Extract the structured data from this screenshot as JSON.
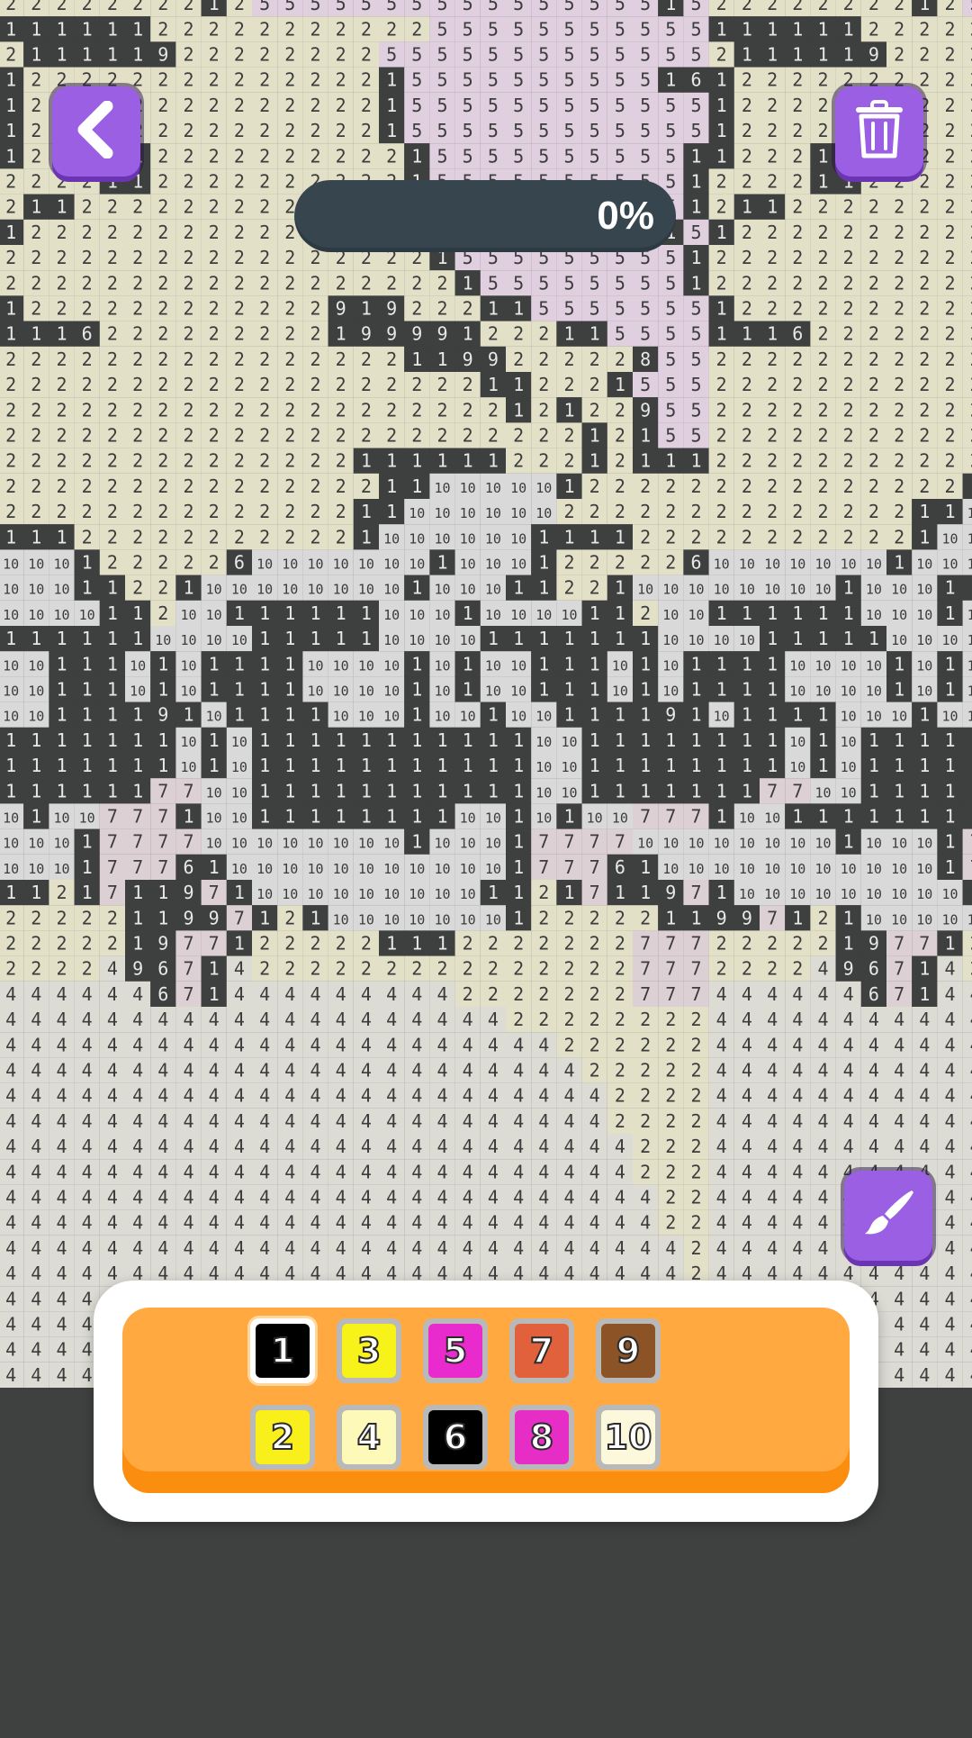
{
  "progress": {
    "value_percent": 0,
    "label": "0%"
  },
  "buttons": {
    "back_icon": "chevron-left-icon",
    "trash_icon": "trash-icon",
    "brush_icon": "paintbrush-icon",
    "accent": "#9b5fe3"
  },
  "palette": {
    "selected": "1",
    "colors": [
      {
        "label": "1",
        "hex": "#000000"
      },
      {
        "label": "3",
        "hex": "#f6f21a"
      },
      {
        "label": "5",
        "hex": "#e92bcd"
      },
      {
        "label": "7",
        "hex": "#e0613c"
      },
      {
        "label": "9",
        "hex": "#8c5326"
      },
      {
        "label": "2",
        "hex": "#f8ef1b"
      },
      {
        "label": "4",
        "hex": "#fdf9b8"
      },
      {
        "label": "6",
        "hex": "#000000"
      },
      {
        "label": "8",
        "hex": "#e62ec6"
      },
      {
        "label": "10",
        "hex": "#fcf8dc"
      }
    ]
  },
  "board": {
    "cell_colors": {
      "1": "#3e3f3f",
      "2": "#e3e0c8",
      "3": "#ece9a8",
      "4": "#dcdbd4",
      "5": "#dfcfdf",
      "6": "#3e3f3f",
      "7": "#ddd0d4",
      "8": "#3e3f3f",
      "9": "#3e3f3f",
      "10": "#d9d9d9"
    },
    "rows": [
      "2222222212555555555555555515",
      "1111112222222222255555555555",
      "2111119222222225555555555555",
      "1222222222222221555555555516",
      "1222222222222221555555555555",
      "1222222222222221555555555555",
      "1222112222222222155555555551",
      "2222112222222222155555555551",
      "2112222222222222155555555551",
      "1222222222222222155555555515",
      "2222222222222222215555555551",
      "2222222222222222221555555551",
      "1222222222222919222115555555",
      "1116222222222199991222115555",
      "2222222222222222119922222855",
      "2222222222222222222112221555",
      "2222222222222222222212122955",
      "2222222222222222222222212155",
      "2222222222222211111122212111",
      "2222222222222221110101010101",
      "2222222222222211101010101010",
      "1112222222222211010101010101",
      "1010101222226101010101010101",
      "1010101122110101010101010101",
      "1010101011210101111111010101",
      "1111111010101011111101010101",
      "1010111101101111101010101101",
      "1010111101101111101010101101",
      "1010111191101111101010110101",
      "1111111101101111111111110101",
      "1111111101101111111111110101",
      "1111117710101111111111110101",
      "1011010777110101111111110101",
      "1010101777710101010101010101",
      "1010101777611010101010101010",
      "1121711971101010101010101010",
      "2222211997121101010101010101",
      "2222219771222221112222222777",
      "2222496714222222222222222777",
      "4444446714444444442222222777",
      "4444444444444444444422222222",
      "4444444444444444444444222222",
      "4444444444444444444444422222",
      "4444444444444444444444442222",
      "4444444444444444444444442222",
      "4444444444444444444444444222",
      "4444444444444444444444444222",
      "4444444444444444444444444422",
      "4444444444444444444444444422",
      "4444444444444444444444444442",
      "4444444444444444444444444442",
      "4444444444444444444444444441",
      "4444444444444444444444444441",
      "4444444444444444444444444441",
      "4444444444444444444444444441"
    ]
  }
}
